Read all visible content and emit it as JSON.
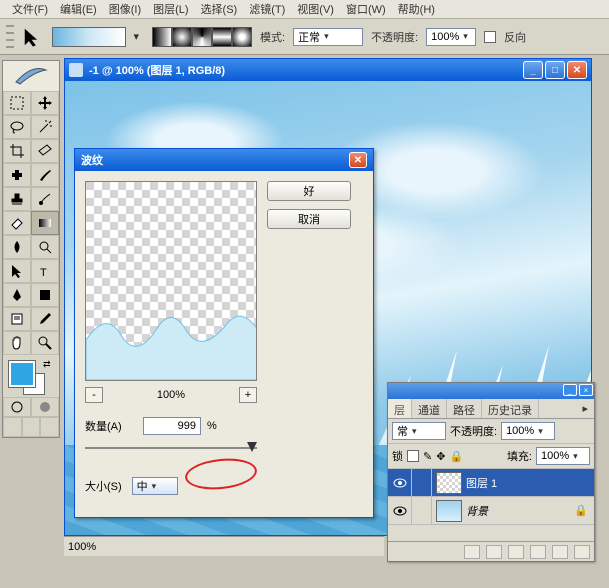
{
  "menu": {
    "file": "文件(F)",
    "edit": "编辑(E)",
    "image": "图像(I)",
    "layer": "图层(L)",
    "select": "选择(S)",
    "filter": "滤镜(T)",
    "view": "视图(V)",
    "window": "窗口(W)",
    "help": "帮助(H)"
  },
  "options": {
    "mode_label": "模式:",
    "mode_value": "正常",
    "opacity_label": "不透明度:",
    "opacity_value": "100%",
    "reverse_label": "反向"
  },
  "document": {
    "title": "-1 @ 100% (图层 1, RGB/8)"
  },
  "dialog": {
    "title": "波纹",
    "ok": "好",
    "cancel": "取消",
    "zoom": "100%",
    "minus": "-",
    "plus": "+",
    "amount_label": "数量(A)",
    "amount_value": "999",
    "amount_unit": "%",
    "size_label": "大小(S)",
    "size_value": "中"
  },
  "layers_panel": {
    "tabs": {
      "layers": "层",
      "channels": "通道",
      "paths": "路径",
      "history": "历史记录"
    },
    "blend": "常",
    "opacity_label": "不透明度:",
    "opacity_value": "100%",
    "lock_label": "锁",
    "fill_label": "填充:",
    "fill_value": "100%",
    "rows": [
      {
        "name": "图层 1"
      },
      {
        "name": "背景"
      }
    ]
  },
  "status": {
    "zoom": "100%"
  }
}
